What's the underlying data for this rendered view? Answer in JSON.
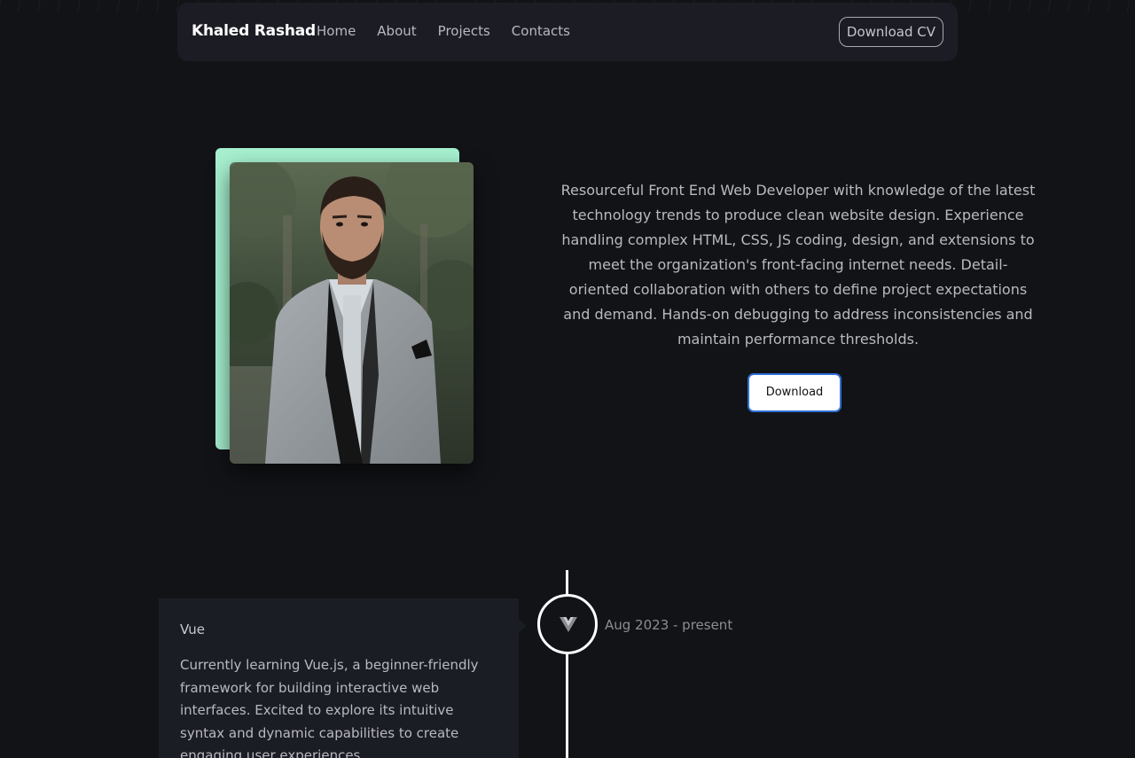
{
  "navbar": {
    "brand": "Khaled Rashad",
    "links": [
      "Home",
      "About",
      "Projects",
      "Contacts"
    ],
    "cv_button": "Download CV"
  },
  "hero": {
    "bio": "Resourceful Front End Web Developer with knowledge of the latest technology trends to produce clean website design. Experience handling complex HTML, CSS, JS coding, design, and extensions to meet the organization's front-facing internet needs. Detail- oriented collaboration with others to define project expectations and demand. Hands-on debugging to address inconsistencies and maintain performance thresholds.",
    "download_button": "Download",
    "photo_icon": "profile-photo"
  },
  "timeline": {
    "items": [
      {
        "title": "Vue",
        "description": "Currently learning Vue.js, a beginner-friendly framework for building interactive web interfaces. Excited to explore its intuitive syntax and dynamic capabilities to create engaging user experiences.",
        "date": "Aug 2023 - present",
        "icon": "vue-icon"
      }
    ]
  },
  "colors": {
    "background": "#121317",
    "navbar": "#1c1d24",
    "accent_mint": "#a6f0cf",
    "button_border": "#2f6fd6",
    "card": "#1b1d24"
  }
}
